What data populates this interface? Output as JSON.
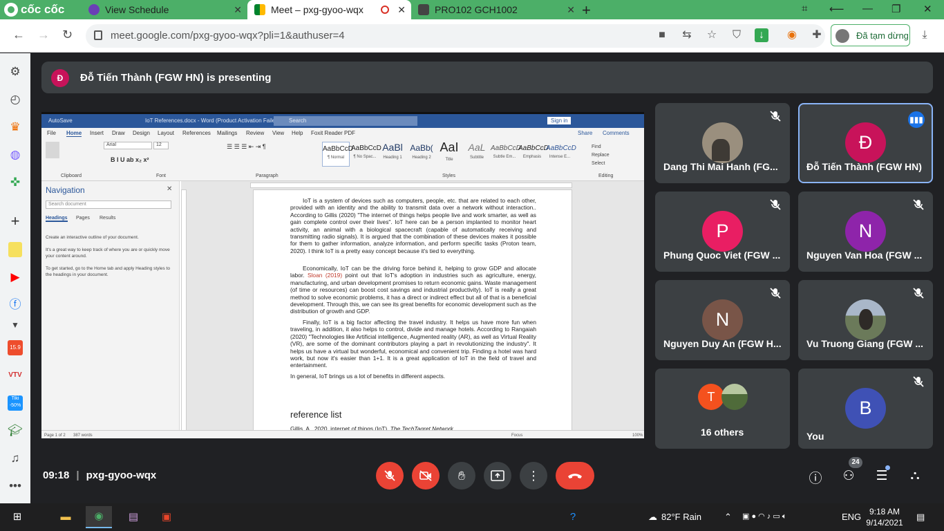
{
  "browser": {
    "brand": "cốc cốc",
    "tabs": [
      {
        "title": "View Schedule",
        "active": false
      },
      {
        "title": "Meet – pxg-gyoo-wqx",
        "active": true
      },
      {
        "title": "PRO102 GCH1002",
        "active": false
      }
    ],
    "url": "meet.google.com/pxg-gyoo-wqx?pli=1&authuser=4",
    "profile_status": "Đã tạm dừng"
  },
  "banner": {
    "avatar_letter": "Đ",
    "text": "Đỗ Tiến Thành (FGW HN) is presenting"
  },
  "word": {
    "autosave": "AutoSave",
    "title": "IoT References.docx - Word (Product Activation Failed)",
    "search": "Search",
    "sign_in": "Sign in",
    "menu": [
      "File",
      "Home",
      "Insert",
      "Draw",
      "Design",
      "Layout",
      "References",
      "Mailings",
      "Review",
      "View",
      "Help",
      "Foxit Reader PDF"
    ],
    "share": "Share",
    "comments": "Comments",
    "font": "Arial",
    "font_size": "12",
    "groups": [
      "Clipboard",
      "Font",
      "Paragraph",
      "Styles",
      "Editing"
    ],
    "styles": [
      {
        "preview": "AaBbCcD",
        "name": "¶ Normal"
      },
      {
        "preview": "AaBbCcD",
        "name": "¶ No Spac..."
      },
      {
        "preview": "AaBl",
        "name": "Heading 1"
      },
      {
        "preview": "AaBb(",
        "name": "Heading 2"
      },
      {
        "preview": "AaI",
        "name": "Title"
      },
      {
        "preview": "AaL",
        "name": "Subtitle"
      },
      {
        "preview": "AaBbCcD",
        "name": "Subtle Em..."
      },
      {
        "preview": "AaBbCcD",
        "name": "Emphasis"
      },
      {
        "preview": "AaBbCcD",
        "name": "Intense E..."
      }
    ],
    "editing": [
      "Find",
      "Replace",
      "Select"
    ],
    "nav": {
      "title": "Navigation",
      "search_placeholder": "Search document",
      "tabs": [
        "Headings",
        "Pages",
        "Results"
      ],
      "help1": "Create an interactive outline of your document.",
      "help2": "It's a great way to keep track of where you are or quickly move your content around.",
      "help3": "To get started, go to the Home tab and apply Heading styles to the headings in your document."
    },
    "doc": {
      "p1": "IoT is a system of devices such as computers, people, etc. that are related to each other, provided with an identity and the ability to transmit data over a network without interaction.. According to Gillis (2020) \"The internet of things helps people live and work smarter, as well as gain complete control over their lives\". IoT here can be a person implanted to monitor heart activity, an animal with a biological spacecraft (capable of automatically receiving and transmitting radio signals). It is argued that the combination of these devices makes it possible for them to gather information, analyze information, and perform specific tasks (Proton team, 2020). I think IoT is a pretty easy concept because it's tied to everything.",
      "p2a": "Economically, IoT can be the driving force behind it, helping to grow GDP and allocate labor. ",
      "p2cite": "Sloan (2019)",
      "p2b": " point out that IoT's adoption in industries such as agriculture, energy, manufacturing, and urban development promises to return economic gains. Waste management (of time or resources) can boost cost savings and industrial productivity). IoT is really a great method to solve economic problems, it has a direct or indirect effect but all of that is a beneficial development. Through this, we can see its great benefits for economic development such as the distribution of growth and GDP.",
      "p3": "Finally, IoT is a big factor affecting the travel industry. It helps us have more fun when traveling, in addition, it also helps to control, divide and manage hotels. According to Rangaiah (2020) \"Technologies like Artificial intelligence, Augmented reality (AR), as well as Virtual Reality (VR), are some of the dominant contributors playing a part in revolutionizing the industry\". It helps us have a virtual but wonderful, economical and convenient trip. Finding a hotel was hard work, but now it's easier than 1+1. It is a great application of IoT in the field of travel and entertainment.",
      "p4": "In general, IoT brings us a lot of benefits in different aspects.",
      "heading": "reference list",
      "ref1a": "Gillis, A., 2020. internet of things (IoT). ",
      "ref1b": "The TechTagret Network."
    },
    "status": {
      "page": "Page 1 of 2",
      "words": "387 words",
      "focus": "Focus",
      "zoom": "100%"
    }
  },
  "participants": [
    {
      "name": "Dang Thi Mai Hanh (FG...",
      "avatar": "",
      "color": "#9a8f7e",
      "muted": true
    },
    {
      "name": "Đỗ Tiến Thành (FGW HN)",
      "avatar": "Đ",
      "color": "#c8135a",
      "muted": false
    },
    {
      "name": "Phung Quoc Viet (FGW ...",
      "avatar": "P",
      "color": "#e91e63",
      "muted": true
    },
    {
      "name": "Nguyen Van Hoa (FGW ...",
      "avatar": "N",
      "color": "#8e24aa",
      "muted": true
    },
    {
      "name": "Nguyen Duy An (FGW H...",
      "avatar": "N",
      "color": "#795548",
      "muted": true
    },
    {
      "name": "Vu Truong Giang (FGW ...",
      "avatar": "",
      "color": "#6b7a5a",
      "muted": true
    },
    {
      "name": "16 others",
      "avatar": "T",
      "color": "#f4511e",
      "muted": false
    },
    {
      "name": "You",
      "avatar": "B",
      "color": "#3f51b5",
      "muted": true
    }
  ],
  "meeting": {
    "time": "09:18",
    "code": "pxg-gyoo-wqx",
    "people_count": "24"
  },
  "taskbar": {
    "weather": "82°F  Rain",
    "lang": "ENG",
    "time": "9:18 AM",
    "date": "9/14/2021"
  },
  "colors": {
    "accent_green": "#4caf68",
    "end_call_red": "#ea4335",
    "meet_bg": "#202124"
  }
}
